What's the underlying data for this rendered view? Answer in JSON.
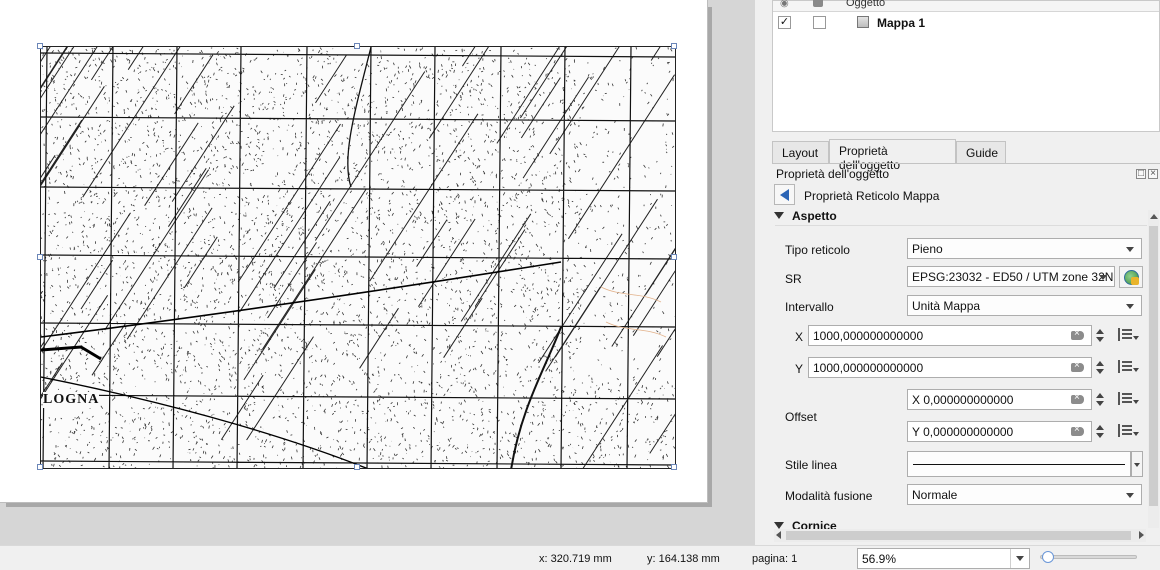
{
  "items_panel": {
    "column_oggetto": "Oggetto",
    "items": [
      {
        "visible": true,
        "locked": false,
        "name": "Mappa 1"
      }
    ]
  },
  "tabs": [
    {
      "label": "Layout",
      "active": false
    },
    {
      "label": "Proprietà dell'oggetto",
      "active": true
    },
    {
      "label": "Guide",
      "active": false
    }
  ],
  "panel": {
    "title": "Proprietà dell'oggetto",
    "subtitle": "Proprietà Reticolo Mappa"
  },
  "sections": {
    "aspetto": "Aspetto",
    "cornice": "Cornice"
  },
  "form": {
    "tipo_reticolo_label": "Tipo reticolo",
    "tipo_reticolo_value": "Pieno",
    "sr_label": "SR",
    "sr_value": "EPSG:23032 - ED50 / UTM zone 32N",
    "intervallo_label": "Intervallo",
    "intervallo_value": "Unità Mappa",
    "x_label": "X",
    "x_value": "1000,000000000000",
    "y_label": "Y",
    "y_value": "1000,000000000000",
    "offset_label": "Offset",
    "offset_x_value": "X 0,000000000000",
    "offset_y_value": "Y 0,000000000000",
    "stile_linea_label": "Stile linea",
    "modalita_fusione_label": "Modalità fusione",
    "modalita_fusione_value": "Normale"
  },
  "map_labels": {
    "left_city": "LOGNA"
  },
  "statusbar": {
    "x": "x: 320.719 mm",
    "y": "y: 164.138 mm",
    "page": "pagina: 1",
    "zoom": "56.9%"
  },
  "colors": {
    "accent": "#2b64b5",
    "selection_handle": "#6b86b8"
  }
}
